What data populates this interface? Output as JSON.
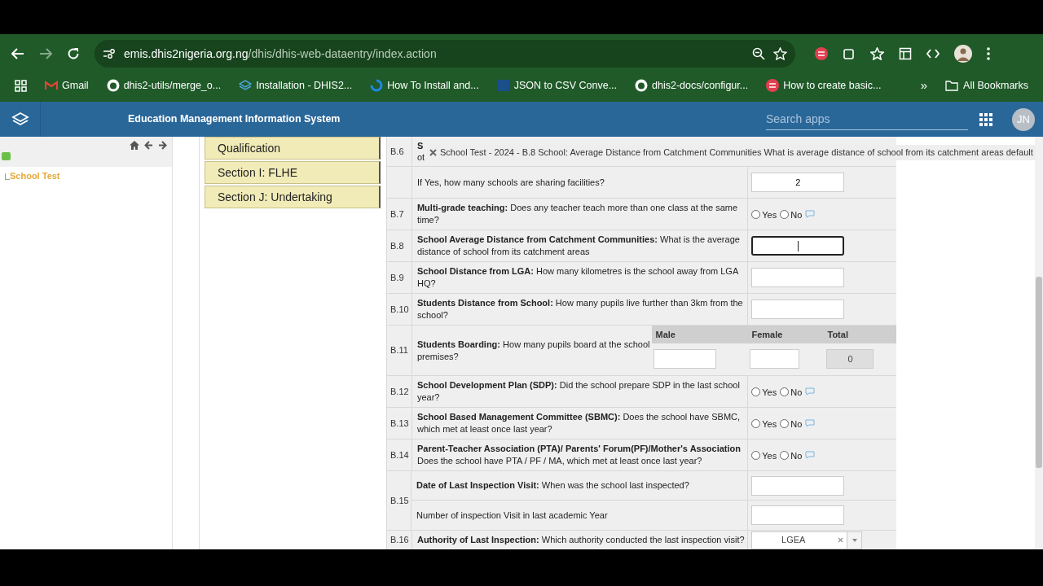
{
  "browser": {
    "url_host": "emis.dhis2nigeria.org.ng",
    "url_path": "/dhis/dhis-web-dataentry/index.action",
    "bookmarks": [
      {
        "label": "Gmail"
      },
      {
        "label": "dhis2-utils/merge_o..."
      },
      {
        "label": "Installation - DHIS2..."
      },
      {
        "label": "How To Install and..."
      },
      {
        "label": "JSON to CSV Conve..."
      },
      {
        "label": "dhis2-docs/configur..."
      },
      {
        "label": "How to create basic..."
      }
    ],
    "overflow": "»",
    "all_bookmarks": "All Bookmarks"
  },
  "header": {
    "title": "Education Management Information System",
    "search_placeholder": "Search apps",
    "avatar": "JN"
  },
  "tree": {
    "items": [
      {
        "label": "School Test",
        "selected": true
      }
    ]
  },
  "sections": [
    {
      "label": "Qualification"
    },
    {
      "label": "Section I: FLHE"
    },
    {
      "label": "Section J: Undertaking"
    }
  ],
  "tooltip": {
    "text": "School Test - 2024 - B.8 School: Average Distance from Catchment Communities What is average distance of school from its catchment areas default"
  },
  "rows": [
    {
      "code": "B.6",
      "items": [
        {
          "kind": "covered",
          "lines": [
            "S",
            "ot"
          ]
        }
      ]
    },
    {
      "code": "",
      "items": [
        {
          "kind": "number",
          "question": "If Yes, how many schools are sharing facilities?",
          "value": "2",
          "focused": false
        }
      ]
    },
    {
      "code": "B.7",
      "items": [
        {
          "kind": "yesno",
          "question": "**Multi-grade teaching:** Does any teacher teach more than one class at the same time?",
          "options": [
            {
              "label": "Yes",
              "selected": false
            },
            {
              "label": "No",
              "selected": false
            }
          ]
        }
      ]
    },
    {
      "code": "B.8",
      "items": [
        {
          "kind": "number",
          "question": "**School Average Distance from Catchment Communities:** What is the average distance of school from its catchment areas",
          "value": "",
          "focused": true
        }
      ]
    },
    {
      "code": "B.9",
      "items": [
        {
          "kind": "number",
          "question": "**School Distance from LGA:** How many kilometres is the school away from LGA HQ?",
          "value": "",
          "focused": false
        }
      ]
    },
    {
      "code": "B.10",
      "items": [
        {
          "kind": "number",
          "question": "**Students Distance from School:** How many pupils live further than 3km from the school?",
          "value": "",
          "focused": false
        }
      ]
    },
    {
      "code": "B.11",
      "items": [
        {
          "kind": "boarding",
          "question": "**Students Boarding:** How many pupils board at the school premises?",
          "columns": [
            "Male",
            "Female",
            "Total"
          ],
          "total": "0"
        }
      ]
    },
    {
      "code": "B.12",
      "items": [
        {
          "kind": "yesno",
          "question": "**School Development Plan (SDP):** Did the school prepare SDP in the last school year?",
          "options": [
            {
              "label": "Yes",
              "selected": false
            },
            {
              "label": "No",
              "selected": false
            }
          ]
        }
      ]
    },
    {
      "code": "B.13",
      "items": [
        {
          "kind": "yesno",
          "question": "**School Based Management Committee (SBMC):** Does the school have SBMC, which met at least once last year?",
          "options": [
            {
              "label": "Yes",
              "selected": false
            },
            {
              "label": "No",
              "selected": false
            }
          ]
        }
      ]
    },
    {
      "code": "B.14",
      "items": [
        {
          "kind": "yesno",
          "question": "**Parent-Teacher Association (PTA)/ Parents' Forum(PF)/Mother's Association** Does the school have PTA / PF / MA, which met at least once last year?",
          "options": [
            {
              "label": "Yes",
              "selected": false
            },
            {
              "label": "No",
              "selected": false
            }
          ]
        }
      ]
    },
    {
      "code": "B.15",
      "items": [
        {
          "kind": "number",
          "question": "**Date of Last Inspection Visit:** When was the school last inspected?",
          "value": "",
          "focused": false
        },
        {
          "kind": "number",
          "question": "Number of inspection Visit in last academic Year",
          "value": "",
          "focused": false
        }
      ]
    },
    {
      "code": "B.16",
      "items": [
        {
          "kind": "select",
          "question": "**Authority of Last Inspection:** Which authority conducted the last inspection visit?",
          "value": "LGEA"
        }
      ]
    }
  ]
}
